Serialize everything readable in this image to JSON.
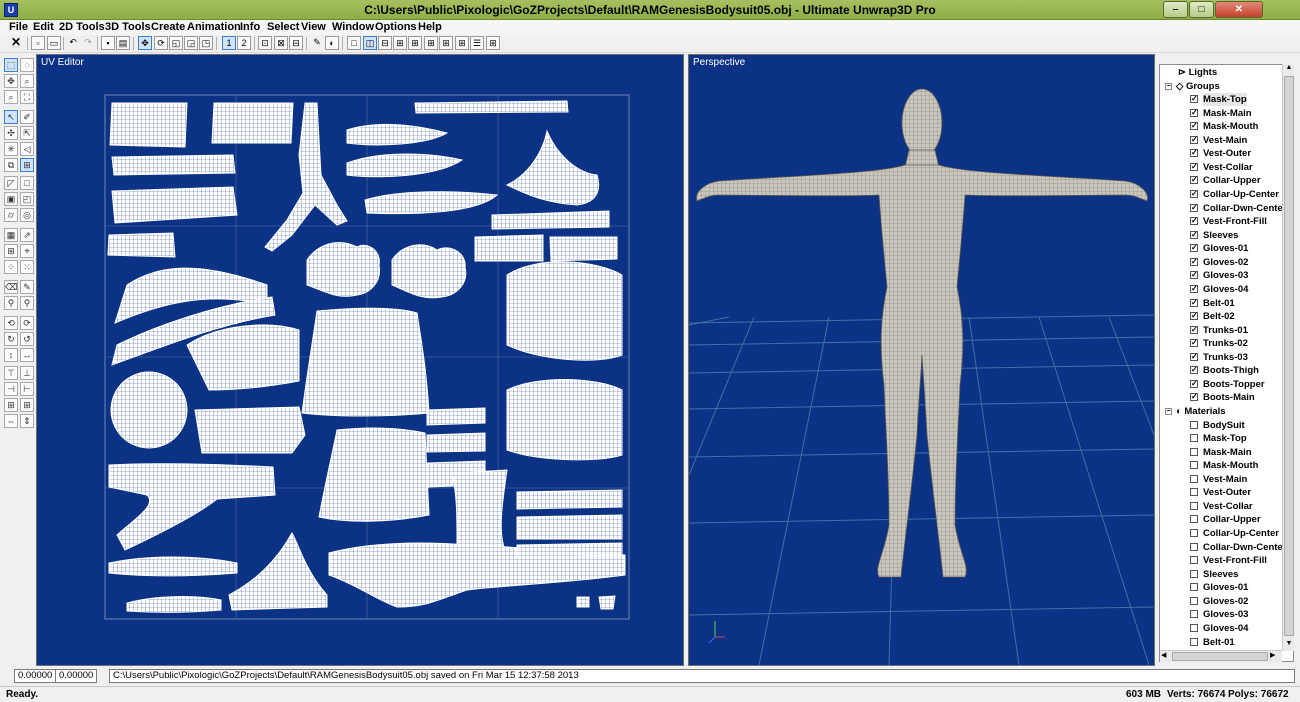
{
  "window": {
    "title": "C:\\Users\\Public\\Pixologic\\GoZProjects\\Default\\RAMGenesisBodysuit05.obj - Ultimate Unwrap3D Pro",
    "app_icon": "U",
    "buttons": {
      "minimize": "–",
      "restore": "□",
      "close": "✕"
    }
  },
  "menu": [
    "File",
    "Edit",
    "2D Tools",
    "3D Tools",
    "Create",
    "Animation",
    "Info",
    "Select",
    "View",
    "Window",
    "Options",
    "Help"
  ],
  "toolbar": {
    "view1_label": "1",
    "view2_label": "2"
  },
  "viewports": {
    "uv": {
      "label": "UV Editor"
    },
    "perspective": {
      "label": "Perspective"
    }
  },
  "tree": {
    "lights_label": "Lights",
    "groups_label": "Groups",
    "groups": [
      "Mask-Top",
      "Mask-Main",
      "Mask-Mouth",
      "Vest-Main",
      "Vest-Outer",
      "Vest-Collar",
      "Collar-Upper",
      "Collar-Up-Center",
      "Collar-Dwn-Center",
      "Vest-Front-Fill",
      "Sleeves",
      "Gloves-01",
      "Gloves-02",
      "Gloves-03",
      "Gloves-04",
      "Belt-01",
      "Belt-02",
      "Trunks-01",
      "Trunks-02",
      "Trunks-03",
      "Boots-Thigh",
      "Boots-Topper",
      "Boots-Main"
    ],
    "materials_label": "Materials",
    "materials": [
      "BodySuit",
      "Mask-Top",
      "Mask-Main",
      "Mask-Mouth",
      "Vest-Main",
      "Vest-Outer",
      "Vest-Collar",
      "Collar-Upper",
      "Collar-Up-Center",
      "Collar-Dwn-Center",
      "Vest-Front-Fill",
      "Sleeves",
      "Gloves-01",
      "Gloves-02",
      "Gloves-03",
      "Gloves-04",
      "Belt-01"
    ],
    "selected_group": "Mask-Top"
  },
  "bottom": {
    "coord_u": "0.00000",
    "coord_v": "0.00000",
    "message": "C:\\Users\\Public\\Pixologic\\GoZProjects\\Default\\RAMGenesisBodysuit05.obj saved on Fri Mar 15 12:37:58 2013"
  },
  "status": {
    "ready": "Ready.",
    "memory": "603 MB",
    "verts": "Verts: 76674",
    "polys": "Polys: 76672"
  },
  "colors": {
    "viewport_bg": "#0b3284",
    "titlebar": "#9bb653",
    "uv_islands": "#ffffff",
    "mesh": "#b5b2ab"
  }
}
